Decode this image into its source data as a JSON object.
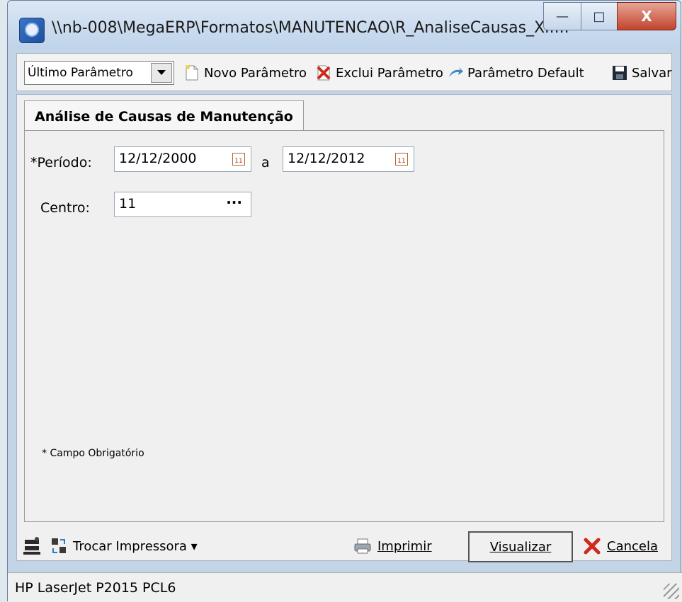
{
  "window": {
    "title": "\\\\nb-008\\MegaERP\\Formatos\\MANUTENCAO\\R_AnaliseCausas_XI....",
    "minimize_glyph": "—",
    "maximize_glyph": "□",
    "close_glyph": "X"
  },
  "toolbar": {
    "param_select_value": "Último Parâmetro",
    "new_param_label": "Novo Parâmetro",
    "delete_param_label": "Exclui Parâmetro",
    "default_param_label": "Parâmetro Default",
    "save_label": "Salvar"
  },
  "tab": {
    "label": "Análise de Causas de Manutenção"
  },
  "form": {
    "period_label": "*Período:",
    "period_from": "12/12/2000",
    "period_sep": "a",
    "period_to": "12/12/2012",
    "center_label": "Centro:",
    "center_value": "11",
    "center_browse": "···",
    "required_note": "* Campo Obrigatório"
  },
  "bottom": {
    "change_printer_label": "Trocar Impressora ▾",
    "print_label": "Imprimir",
    "view_label": "Visualizar",
    "cancel_label": "Cancela"
  },
  "status": {
    "printer_name": "HP LaserJet P2015 PCL6"
  },
  "colors": {
    "title_bar": "#c3d4e7",
    "close_button": "#c2432d",
    "panel": "#f0f0f0"
  }
}
